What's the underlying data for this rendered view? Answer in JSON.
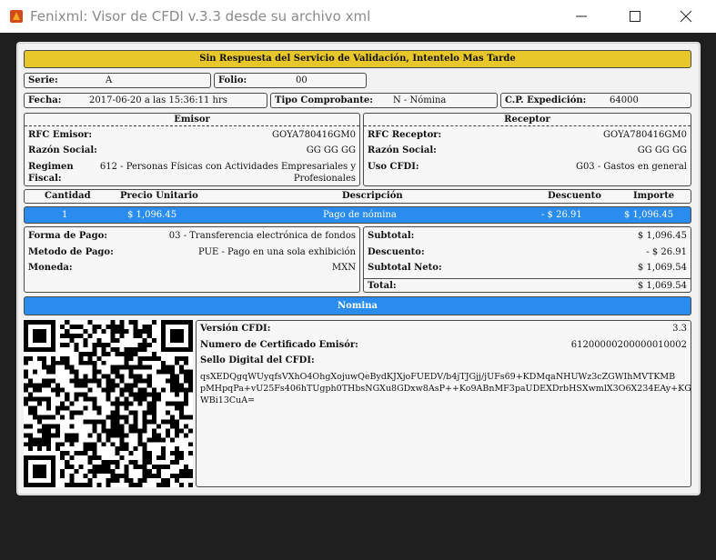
{
  "window": {
    "title": "Fenixml: Visor de CFDI v.3.3 desde su archivo xml"
  },
  "alert": "Sin Respuesta del Servicio de Validación, Intentelo Mas Tarde",
  "header": {
    "serie_label": "Serie:",
    "serie": "A",
    "folio_label": "Folio:",
    "folio": "00",
    "fecha_label": "Fecha:",
    "fecha": "2017-06-20 a las 15:36:11 hrs",
    "tipo_label": "Tipo Comprobante:",
    "tipo": "N - Nómina",
    "cp_label": "C.P. Expedición:",
    "cp": "64000"
  },
  "emisor": {
    "title": "Emisor",
    "rfc_label": "RFC Emisor:",
    "rfc": "GOYA780416GM0",
    "razon_label": "Razón Social:",
    "razon": "GG GG GG",
    "regimen_label_1": "Regimen",
    "regimen_label_2": "Fiscal:",
    "regimen_1": "612 - Personas Físicas con Actividades Empresariales y",
    "regimen_2": "Profesionales"
  },
  "receptor": {
    "title": "Receptor",
    "rfc_label": "RFC Receptor:",
    "rfc": "GOYA780416GM0",
    "razon_label": "Razón Social:",
    "razon": "GG GG GG",
    "uso_label": "Uso CFDI:",
    "uso": "G03 - Gastos en general"
  },
  "conceptos": {
    "headers": {
      "cantidad": "Cantidad",
      "precio": "Precio Unitario",
      "descripcion": "Descripción",
      "descuento": "Descuento",
      "importe": "Importe"
    },
    "row": {
      "cantidad": "1",
      "precio": "$ 1,096.45",
      "descripcion": "Pago de nómina",
      "descuento": "- $ 26.91",
      "importe": "$ 1,096.45"
    }
  },
  "pago": {
    "forma_label": "Forma de Pago:",
    "forma": "03 - Transferencia electrónica de fondos",
    "metodo_label": "Metodo de Pago:",
    "metodo": "PUE - Pago en una sola exhibición",
    "moneda_label": "Moneda:",
    "moneda": "MXN"
  },
  "totales": {
    "subtotal_label": "Subtotal:",
    "subtotal": "$ 1,096.45",
    "descuento_label": "Descuento:",
    "descuento": "- $ 26.91",
    "neto_label": "Subtotal Neto:",
    "neto": "$ 1,069.54",
    "total_label": "Total:",
    "total": "$ 1,069.54"
  },
  "nomina_bar": "Nomina",
  "timbre": {
    "version_label": "Versión CFDI:",
    "version": "3.3",
    "cert_label": "Numero de Certificado Emisór:",
    "cert": "61200000200000010002",
    "sello_label": "Sello Digital del CFDI:",
    "sello_1": "qsXEDQgqWUyqfsVXhO4OhgXojuwQeBydKJXjoFUEDV/b4jTJGjj/jUFs69+KDMqaNHUWz3cZGWIhMVTKMB",
    "sello_2": "pMHpqPa+vU25Fs406hTUgph0THbsNGXu8GDxw8AsP++Ko9ABnMF3paUDEXDrbHSXwmlX3O6X234EAy+KG",
    "sello_3": "WBi13CuA="
  },
  "icons": {
    "app": "fenix-app-icon",
    "qr": "qr-code"
  },
  "colors": {
    "alert_bg": "#e8c72b",
    "highlight_bg": "#2b8cf0"
  }
}
